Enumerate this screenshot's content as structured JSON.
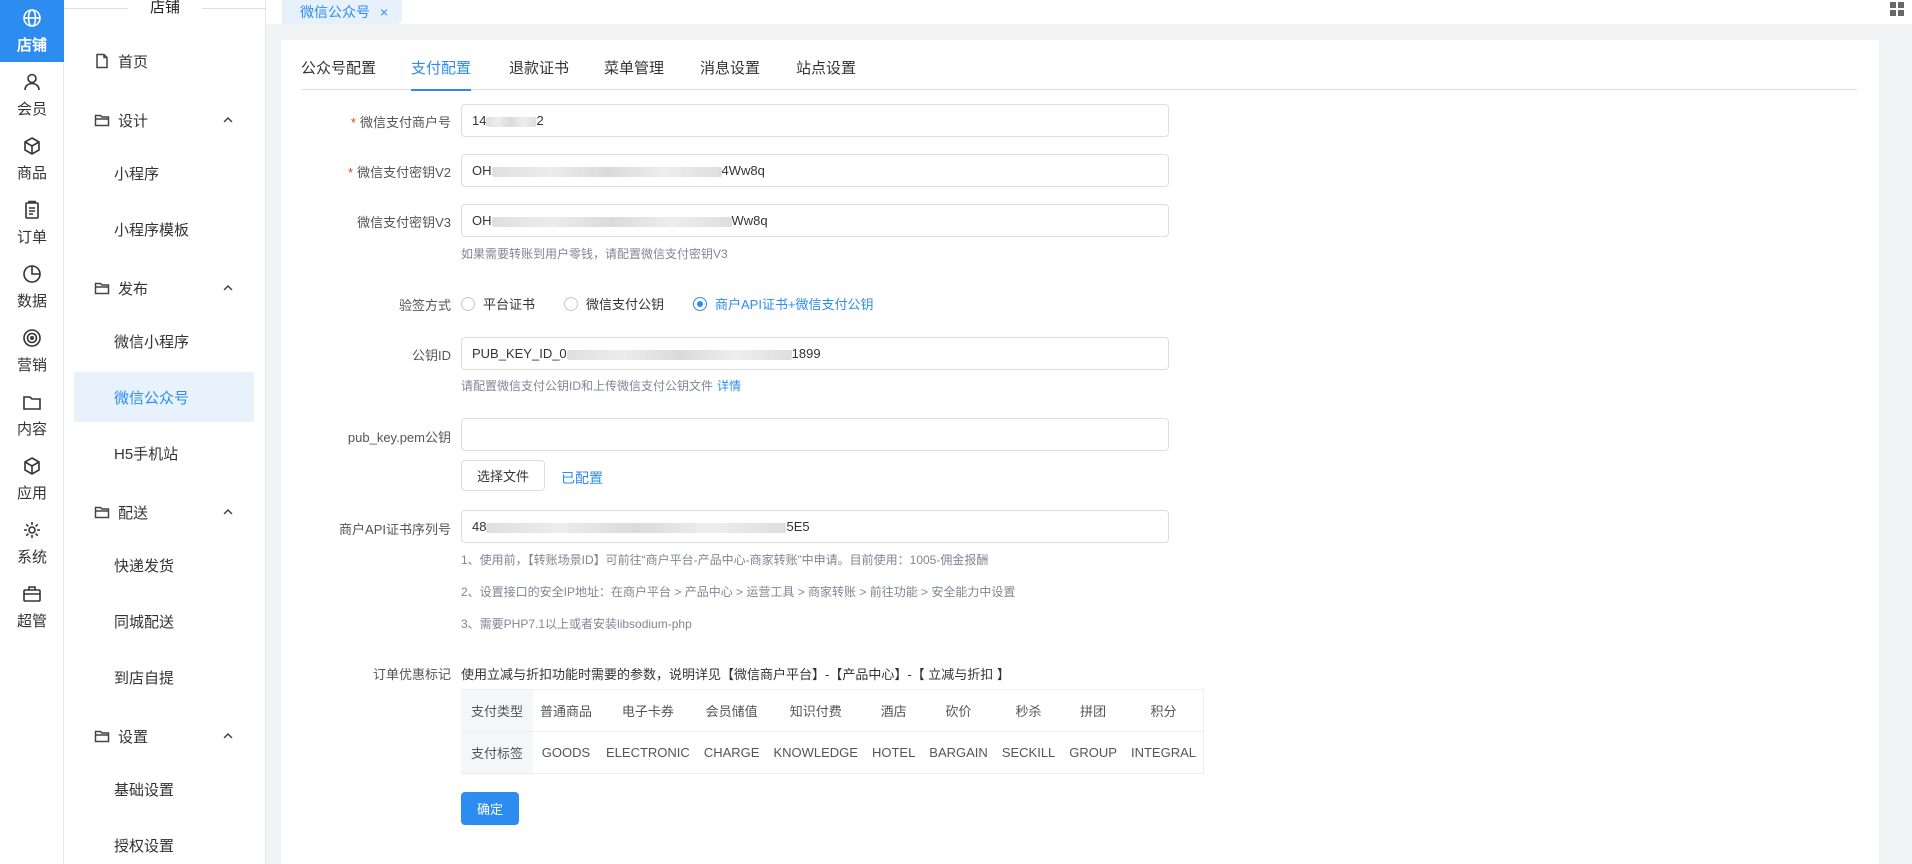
{
  "rail": {
    "items": [
      {
        "label": "店铺",
        "icon": "store-icon",
        "active": true
      },
      {
        "label": "会员",
        "icon": "user-icon"
      },
      {
        "label": "商品",
        "icon": "box-icon"
      },
      {
        "label": "订单",
        "icon": "clipboard-icon"
      },
      {
        "label": "数据",
        "icon": "pie-chart-icon"
      },
      {
        "label": "营销",
        "icon": "target-icon"
      },
      {
        "label": "内容",
        "icon": "folder-icon"
      },
      {
        "label": "应用",
        "icon": "cube-icon"
      },
      {
        "label": "系统",
        "icon": "gear-icon"
      },
      {
        "label": "超管",
        "icon": "briefcase-icon"
      }
    ]
  },
  "sidebar": {
    "title": "店铺",
    "home": "首页",
    "groups": {
      "design": "设计",
      "publish": "发布",
      "delivery": "配送",
      "settings": "设置"
    },
    "items": {
      "miniprogram": "小程序",
      "miniprogram_template": "小程序模板",
      "wechat_miniprogram": "微信小程序",
      "wechat_official": "微信公众号",
      "h5": "H5手机站",
      "express": "快递发货",
      "local_delivery": "同城配送",
      "pickup": "到店自提",
      "basic_settings": "基础设置",
      "auth_settings": "授权设置"
    }
  },
  "topbar": {
    "page_tab": "微信公众号",
    "close": "×"
  },
  "tabs": [
    "公众号配置",
    "支付配置",
    "退款证书",
    "菜单管理",
    "消息设置",
    "站点设置"
  ],
  "active_tab": 1,
  "form": {
    "merchant_id_label": "微信支付商户号",
    "merchant_id_prefix": "14",
    "merchant_id_suffix": "2",
    "key_v2_label": "微信支付密钥V2",
    "key_v2_prefix": "OH",
    "key_v2_suffix": "4Ww8q",
    "key_v3_label": "微信支付密钥V3",
    "key_v3_prefix": "OH",
    "key_v3_suffix": "Ww8q",
    "key_v3_hint": "如果需要转账到用户零钱，请配置微信支付密钥V3",
    "verify_label": "验签方式",
    "verify_options": [
      "平台证书",
      "微信支付公钥",
      "商户API证书+微信支付公钥"
    ],
    "verify_selected": 2,
    "pubkey_id_label": "公钥ID",
    "pubkey_id_prefix": "PUB_KEY_ID_0",
    "pubkey_id_suffix": "1899",
    "pubkey_id_hint": "请配置微信支付公钥ID和上传微信支付公钥文件",
    "pubkey_id_hint_link": "详情",
    "pem_label": "pub_key.pem公钥",
    "pem_value": "",
    "choose_file": "选择文件",
    "configured": "已配置",
    "serial_label": "商户API证书序列号",
    "serial_prefix": "48",
    "serial_suffix": "5E5",
    "serial_notes": [
      "1、使用前，【转账场景ID】可前往“商户平台-产品中心-商家转账”中申请。目前使用：1005-佣金报酬",
      "2、设置接口的安全IP地址：在商户平台 > 产品中心 > 运营工具 > 商家转账 > 前往功能 > 安全能力中设置",
      "3、需要PHP7.1以上或者安装libsodium-php"
    ],
    "discount_label": "订单优惠标记",
    "discount_desc": "使用立减与折扣功能时需要的参数，说明详见【微信商户平台】-【产品中心】-【 立减与折扣 】",
    "submit": "确定"
  },
  "tag_table": {
    "type_header": "支付类型",
    "tag_header": "支付标签",
    "types": [
      "普通商品",
      "电子卡券",
      "会员储值",
      "知识付费",
      "酒店",
      "砍价",
      "秒杀",
      "拼团",
      "积分"
    ],
    "tags": [
      "GOODS",
      "ELECTRONIC",
      "CHARGE",
      "KNOWLEDGE",
      "HOTEL",
      "BARGAIN",
      "SECKILL",
      "GROUP",
      "INTEGRAL"
    ]
  },
  "colors": {
    "primary": "#2d8cf0",
    "required": "#ed4014",
    "brand_pill": "#ff8a00"
  }
}
